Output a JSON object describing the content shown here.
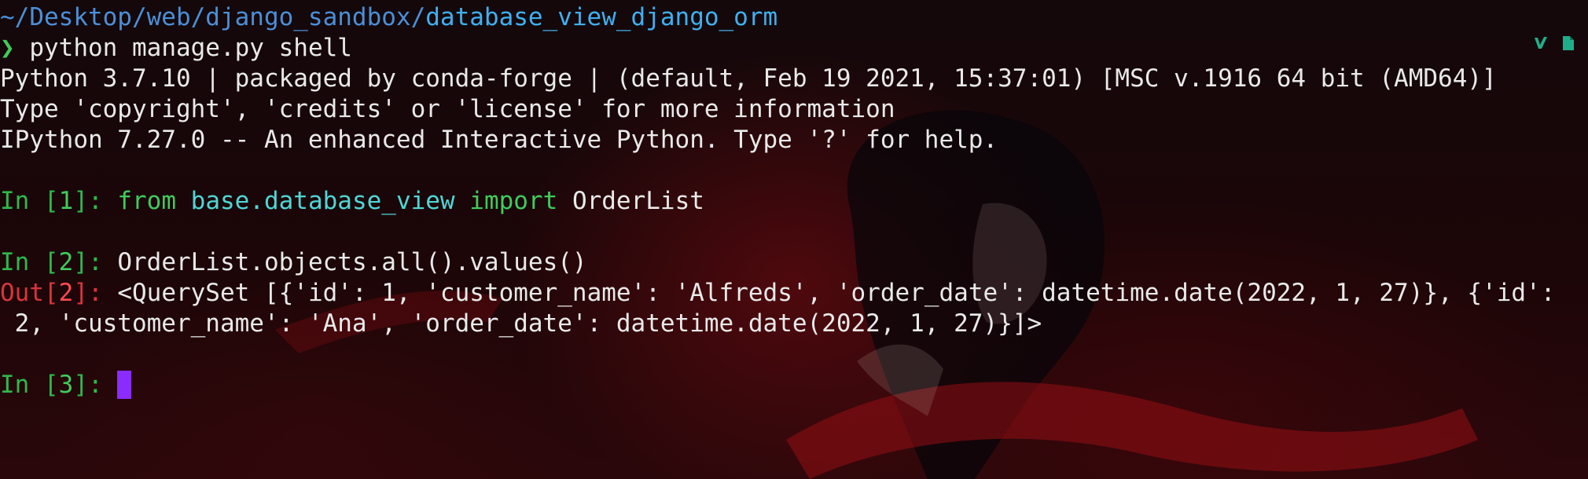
{
  "prompt": {
    "path_prefix": "~/Desktop/web/django_sandbox/",
    "path_current": "database_view_django_orm",
    "symbol": "❯",
    "command": "python manage.py shell"
  },
  "banner": [
    "Python 3.7.10 | packaged by conda-forge | (default, Feb 19 2021, 15:37:01) [MSC v.1916 64 bit (AMD64)]",
    "Type 'copyright', 'credits' or 'license' for more information",
    "IPython 7.27.0 -- An enhanced Interactive Python. Type '?' for help."
  ],
  "cells": {
    "in1": {
      "label_pre": "In [",
      "num": "1",
      "label_post": "]: ",
      "kw_from": "from",
      "module": "base.database_view",
      "kw_import": "import",
      "name": "OrderList"
    },
    "in2": {
      "label_pre": "In [",
      "num": "2",
      "label_post": "]: ",
      "code": "OrderList.objects.all().values()"
    },
    "out2": {
      "label_pre": "Out[",
      "num": "2",
      "label_post": "]: ",
      "line1": "<QuerySet [{'id': 1, 'customer_name': 'Alfreds', 'order_date': datetime.date(2022, 1, 27)}, {'id':",
      "line2": " 2, 'customer_name': 'Ana', 'order_date': datetime.date(2022, 1, 27)}]>"
    },
    "in3": {
      "label_pre": "In [",
      "num": "3",
      "label_post": "]: "
    }
  },
  "tray_icons": [
    "vim-check-icon",
    "file-icon"
  ],
  "colors": {
    "path": "#4a8fd8",
    "path_current": "#3fb0f0",
    "in_prompt": "#2fb84a",
    "out_prompt": "#d8343c",
    "module": "#4fd6d6",
    "cursor": "#8b2cff"
  }
}
